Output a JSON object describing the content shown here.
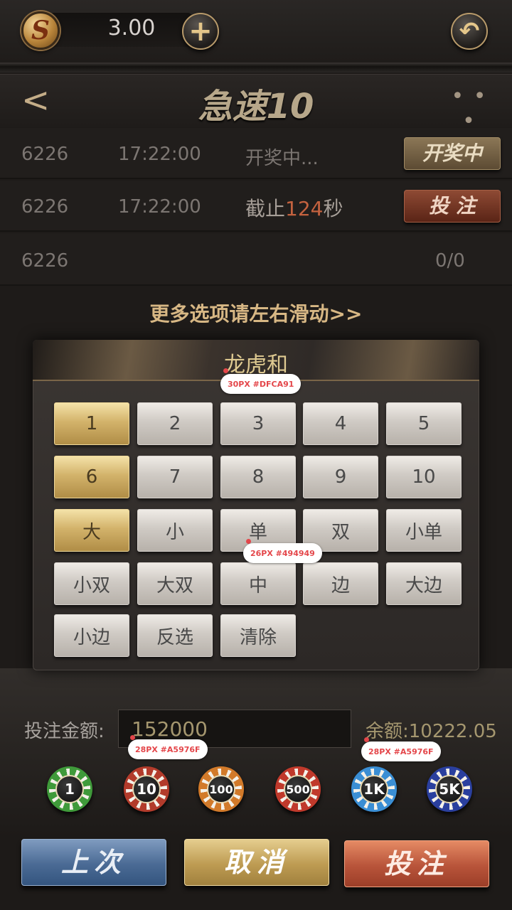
{
  "topbar": {
    "balance": "3.00",
    "coin_glyph": "S",
    "add_glyph": "+",
    "back_glyph": "↶"
  },
  "header": {
    "back_glyph": "<",
    "title": "急速10",
    "more_glyph": "• • •"
  },
  "rows": [
    {
      "issue": "6226",
      "time": "17:22:00",
      "status": "开奖中...",
      "button": "开奖中"
    },
    {
      "issue": "6226",
      "time": "17:22:00",
      "status_prefix": "截止",
      "countdown": "124",
      "status_suffix": "秒",
      "button": "投 注"
    },
    {
      "issue": "6226",
      "count": "0/0"
    }
  ],
  "hint": "更多选项请左右滑动>>",
  "panel": {
    "title": "龙虎和",
    "options": [
      {
        "label": "1",
        "selected": true
      },
      {
        "label": "2",
        "selected": false
      },
      {
        "label": "3",
        "selected": false
      },
      {
        "label": "4",
        "selected": false
      },
      {
        "label": "5",
        "selected": false
      },
      {
        "label": "6",
        "selected": true
      },
      {
        "label": "7",
        "selected": false
      },
      {
        "label": "8",
        "selected": false
      },
      {
        "label": "9",
        "selected": false
      },
      {
        "label": "10",
        "selected": false
      },
      {
        "label": "大",
        "selected": true
      },
      {
        "label": "小",
        "selected": false
      },
      {
        "label": "单",
        "selected": false
      },
      {
        "label": "双",
        "selected": false
      },
      {
        "label": "小单",
        "selected": false
      },
      {
        "label": "小双",
        "selected": false
      },
      {
        "label": "大双",
        "selected": false
      },
      {
        "label": "中",
        "selected": false
      },
      {
        "label": "边",
        "selected": false
      },
      {
        "label": "大边",
        "selected": false
      },
      {
        "label": "小边",
        "selected": false
      },
      {
        "label": "反选",
        "selected": false
      },
      {
        "label": "清除",
        "selected": false
      }
    ]
  },
  "annotations": {
    "title_spec": "30PX #DFCA91",
    "option_spec": "26PX #494949",
    "input_spec": "28PX #A5976F",
    "balance_spec": "28PX #A5976F"
  },
  "bet": {
    "label": "投注金额:",
    "amount": "152000",
    "balance": "余额:10222.05"
  },
  "chips": [
    {
      "label": "1",
      "color": "#3f9a3a"
    },
    {
      "label": "10",
      "color": "#b23b2b"
    },
    {
      "label": "100",
      "color": "#d27a2a"
    },
    {
      "label": "500",
      "color": "#c0392b"
    },
    {
      "label": "1K",
      "color": "#3a8ed4"
    },
    {
      "label": "5K",
      "color": "#2a3f9e"
    }
  ],
  "actions": {
    "last": "上次",
    "cancel": "取消",
    "bet": "投注"
  }
}
